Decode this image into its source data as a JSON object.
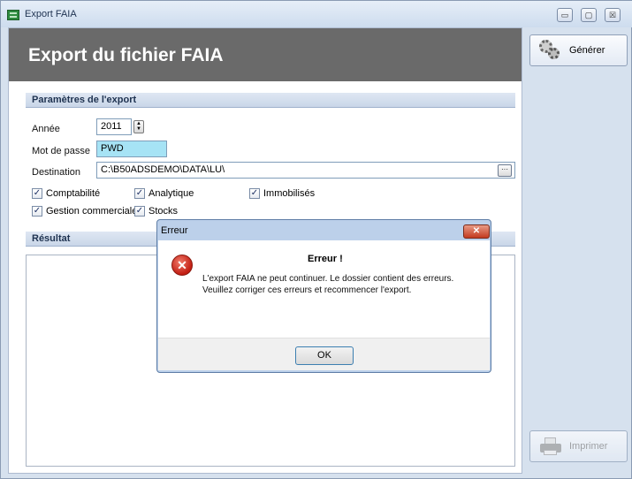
{
  "window": {
    "title": "Export FAIA",
    "minimize_glyph": "▭",
    "maximize_glyph": "▢",
    "close_glyph": "☒"
  },
  "header": {
    "title": "Export du fichier FAIA"
  },
  "params": {
    "section_title": "Paramètres de l'export",
    "year_label": "Année",
    "year_value": "2011",
    "password_label": "Mot de passe",
    "password_value": "PWD",
    "destination_label": "Destination",
    "destination_value": "C:\\B50ADSDEMO\\DATA\\LU\\",
    "browse_glyph": "···",
    "checkboxes": [
      {
        "label": "Comptabilité",
        "checked": true
      },
      {
        "label": "Analytique",
        "checked": true
      },
      {
        "label": "Immobilisés",
        "checked": true
      },
      {
        "label": "Gestion commerciale",
        "checked": true
      },
      {
        "label": "Stocks",
        "checked": true
      }
    ],
    "check_glyph": "✓"
  },
  "result": {
    "section_title": "Résultat"
  },
  "sidebar": {
    "generate_label": "Générer",
    "print_label": "Imprimer"
  },
  "dialog": {
    "title": "Erreur",
    "close_glyph": "✕",
    "heading": "Erreur !",
    "message_line1": "L'export FAIA ne peut continuer. Le dossier contient des erreurs.",
    "message_line2": "Veuillez corriger ces erreurs et recommencer l'export.",
    "ok_label": "OK",
    "icon_glyph": "✕"
  },
  "colors": {
    "header_band": "#6a6a6a",
    "password_highlight": "#a6e3f5",
    "dialog_frame": "#bcd0ea",
    "error_red": "#c21d12"
  }
}
